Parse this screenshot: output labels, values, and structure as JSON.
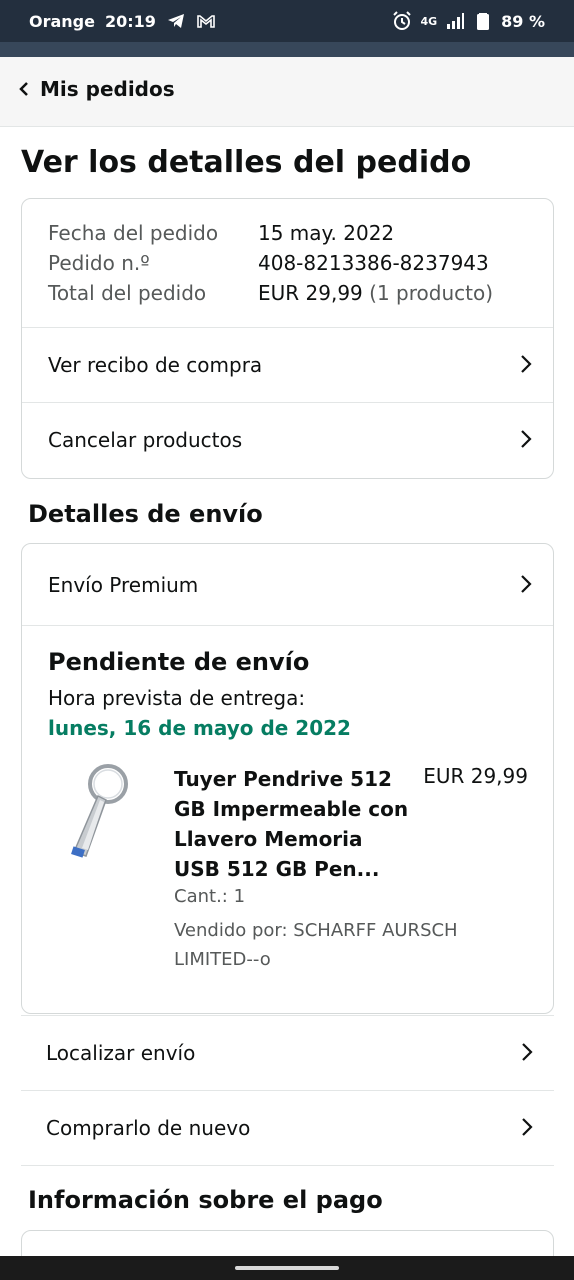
{
  "status_bar": {
    "carrier": "Orange",
    "time": "20:19",
    "network": "4G",
    "battery": "89 %"
  },
  "nav": {
    "back_label": "Mis pedidos"
  },
  "page_title": "Ver los detalles del pedido",
  "summary": {
    "rows": [
      {
        "label": "Fecha del pedido",
        "value": "15 may. 2022"
      },
      {
        "label": "Pedido n.º",
        "value": "408-8213386-8237943"
      },
      {
        "label": "Total del pedido",
        "value": "EUR 29,99",
        "extra": "(1 producto)"
      }
    ],
    "receipt_label": "Ver recibo de compra",
    "cancel_label": "Cancelar productos"
  },
  "shipping": {
    "section_title": "Detalles de envío",
    "method_label": "Envío Premium",
    "status_title": "Pendiente de envío",
    "eta_label": "Hora prevista de entrega:",
    "eta_date": "lunes, 16 de mayo de 2022",
    "product": {
      "title": "Tuyer Pendrive 512 GB Impermeable con Llavero Memoria USB 512 GB Pen...",
      "price": "EUR 29,99",
      "quantity": "Cant.: 1",
      "seller": "Vendido por: SCHARFF AURSCH LIMITED--o"
    }
  },
  "actions": {
    "track_label": "Localizar envío",
    "buy_again_label": "Comprarlo de nuevo"
  },
  "payment": {
    "section_title": "Información sobre el pago"
  },
  "icons": {
    "back": "chevron-left-icon",
    "row": "chevron-right-icon",
    "telegram": "telegram-icon",
    "gmail": "gmail-icon",
    "alarm": "alarm-icon",
    "signal": "signal-icon",
    "battery": "battery-icon"
  },
  "colors": {
    "status_bar": "#232f3e",
    "eta_green": "#067d62",
    "muted_text": "#565959",
    "border": "#d5d9d9"
  }
}
